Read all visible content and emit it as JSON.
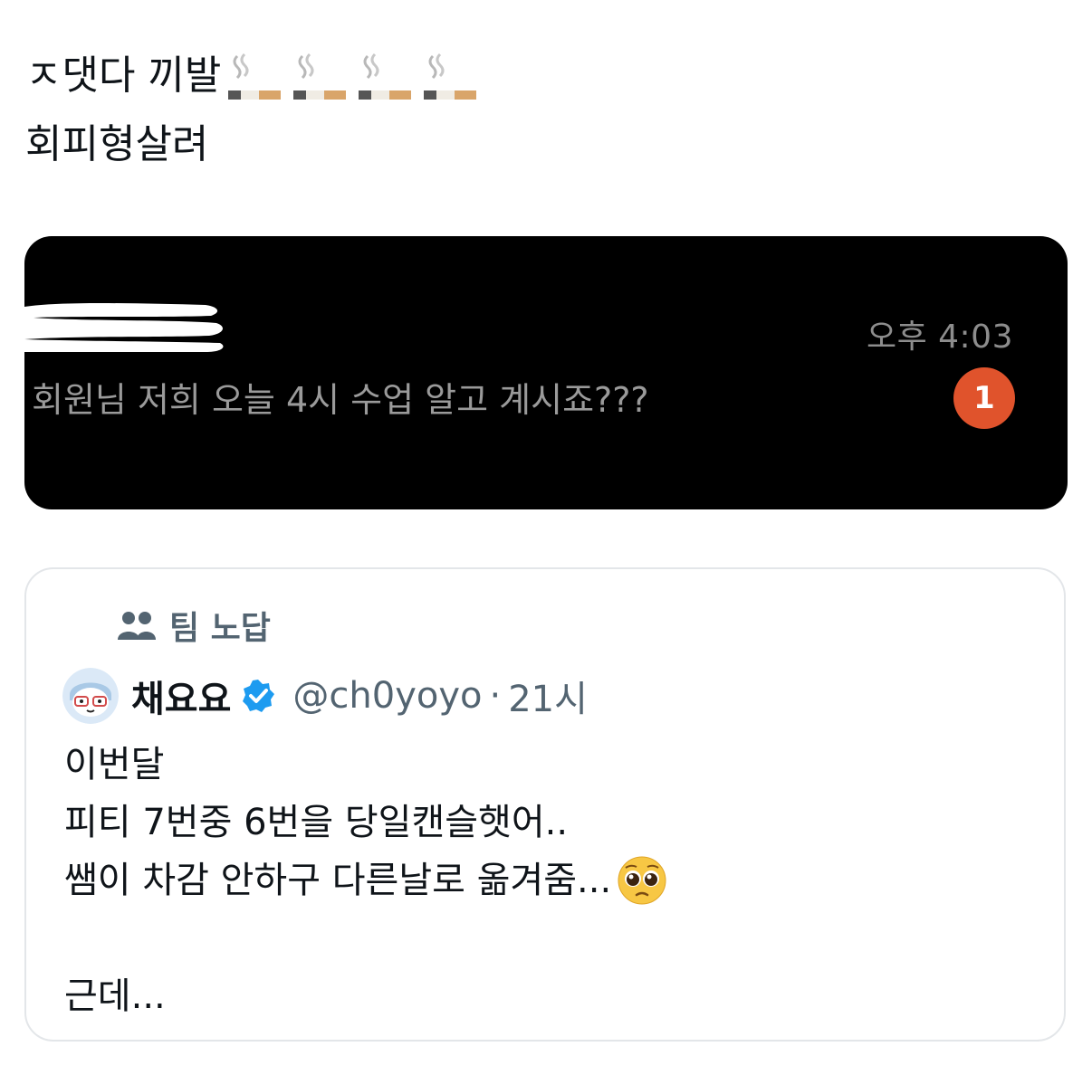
{
  "tweet": {
    "line1": "ㅈ댓다 끼발",
    "line1_emoji": "cigarette-emoji",
    "line1_emoji_count": 4,
    "line2": "회피형살려"
  },
  "media": {
    "time": "오후 4:03",
    "message": "회원님 저희 오늘 4시 수업 알고 계시죠???",
    "badge": "1",
    "badge_color": "#e0532c"
  },
  "quote": {
    "community": "팀 노답",
    "author_name": "채요요",
    "handle": "@ch0yoyo",
    "separator": "·",
    "time": "21시",
    "lines": [
      "이번달",
      "피티 7번중 6번을 당일캔슬햇어..",
      "쌤이 차감 안하구 다른날로 옮겨줌...",
      "",
      "근데..."
    ],
    "line3_emoji": "pleading-face-emoji",
    "verified_color": "#1d9bf0"
  }
}
